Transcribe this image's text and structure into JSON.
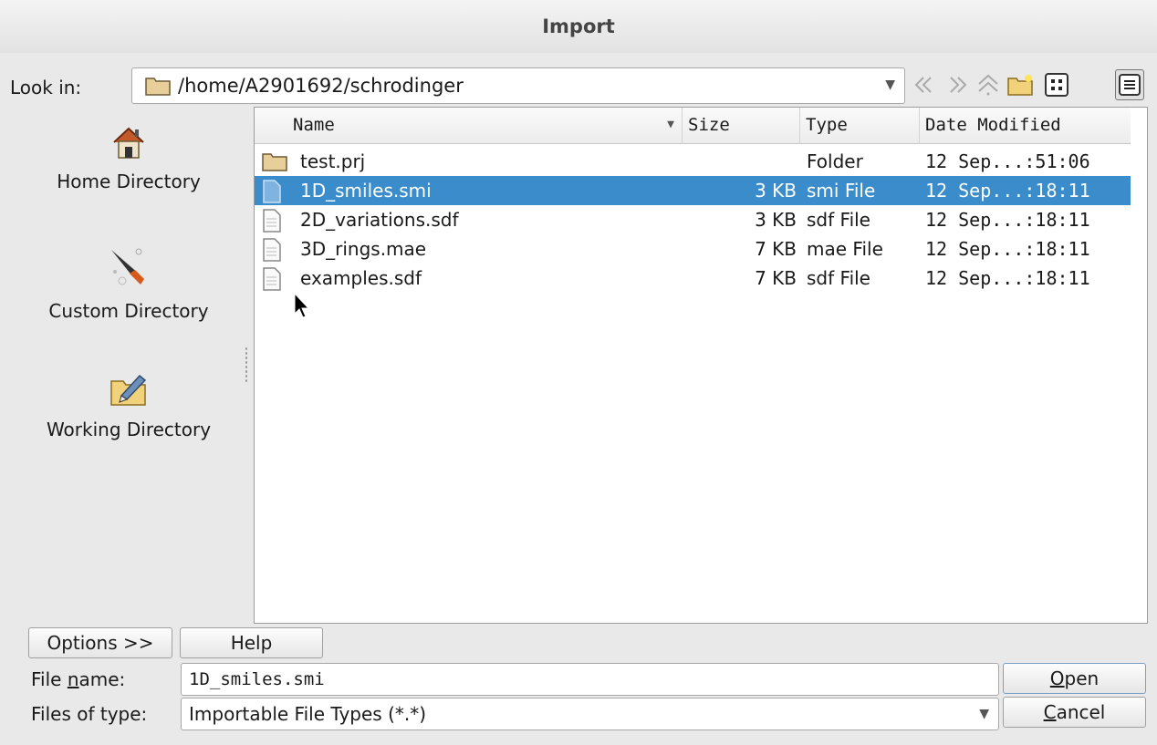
{
  "window": {
    "title": "Import"
  },
  "look_in": {
    "label": "Look in:",
    "path": "/home/A2901692/schrodinger",
    "toolbar": [
      "back-icon",
      "forward-icon",
      "parent-directory-icon",
      "new-folder-icon",
      "icon-view-icon",
      "detail-view-icon"
    ]
  },
  "sidebar": {
    "items": [
      {
        "label": "Home Directory",
        "icon": "home-icon"
      },
      {
        "label": "Custom Directory",
        "icon": "rocket-icon"
      },
      {
        "label": "Working Directory",
        "icon": "folder-edit-icon"
      }
    ]
  },
  "file_list": {
    "columns": [
      "Name",
      "Size",
      "Type",
      "Date Modified"
    ],
    "rows": [
      {
        "name": "test.prj",
        "size": "",
        "type": "Folder",
        "date": "12 Sep...:51:06",
        "icon": "folder-icon",
        "selected": false
      },
      {
        "name": "1D_smiles.smi",
        "size": "3 KB",
        "type": "smi File",
        "date": "12 Sep...:18:11",
        "icon": "file-icon",
        "selected": true
      },
      {
        "name": "2D_variations.sdf",
        "size": "3 KB",
        "type": "sdf File",
        "date": "12 Sep...:18:11",
        "icon": "file-icon",
        "selected": false
      },
      {
        "name": "3D_rings.mae",
        "size": "7 KB",
        "type": "mae File",
        "date": "12 Sep...:18:11",
        "icon": "file-icon",
        "selected": false
      },
      {
        "name": "examples.sdf",
        "size": "7 KB",
        "type": "sdf File",
        "date": "12 Sep...:18:11",
        "icon": "file-icon",
        "selected": false
      }
    ]
  },
  "bottom": {
    "options_label": "Options >>",
    "help_label": "Help",
    "file_name_label_pre": "File ",
    "file_name_label_u": "n",
    "file_name_label_post": "ame:",
    "file_name_value": "1D_smiles.smi",
    "files_of_type_label": "Files of type:",
    "files_of_type_value": "Importable File Types (*.*)",
    "open_u": "O",
    "open_rest": "pen",
    "cancel_u": "C",
    "cancel_rest": "ancel"
  },
  "colors": {
    "selection": "#3b8ccb",
    "background": "#e9e9e9"
  }
}
